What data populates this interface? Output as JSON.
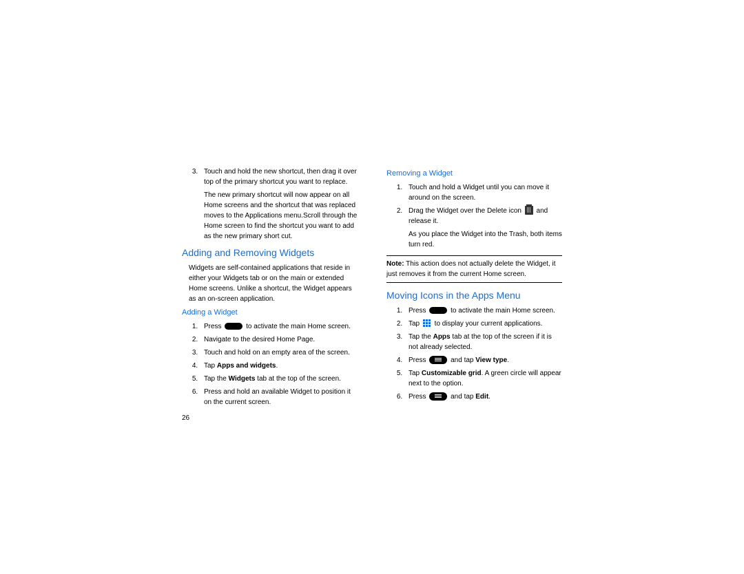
{
  "pageNumber": "26",
  "left": {
    "topList": {
      "start": 3,
      "items": [
        {
          "text": "Touch and hold the new shortcut, then drag it over top of the primary shortcut you want to replace.",
          "after": "The new primary shortcut will now appear on all Home screens and the shortcut that was replaced moves to the Applications menu.Scroll through the Home screen to find the shortcut you want to add as the new primary short cut."
        }
      ]
    },
    "section1": {
      "title": "Adding and Removing Widgets",
      "intro": "Widgets are self-contained applications that reside in either your Widgets tab or on the main or extended Home screens. Unlike a shortcut, the Widget appears as an on-screen application.",
      "sub": "Adding a Widget",
      "steps": [
        {
          "pre": "Press ",
          "icon": "home",
          "post": " to activate the main Home screen."
        },
        {
          "text": "Navigate to the desired Home Page."
        },
        {
          "text": "Touch and hold on an empty area of the screen."
        },
        {
          "pre": "Tap ",
          "bold": "Apps and widgets",
          "post": "."
        },
        {
          "pre": "Tap the ",
          "bold": "Widgets",
          "post": " tab at the top of the screen."
        },
        {
          "text": "Press and hold an available Widget to position it on the current screen."
        }
      ]
    }
  },
  "right": {
    "sub": "Removing a Widget",
    "steps": [
      {
        "text": "Touch and hold a Widget until you can move it around on the screen."
      },
      {
        "pre": "Drag the Widget over the Delete icon ",
        "icon": "trash",
        "post": " and release it.",
        "after": "As you place the Widget into the Trash, both items turn red."
      }
    ],
    "note": {
      "label": "Note:",
      "text": " This action does not actually delete the Widget, it just removes it from the current Home screen."
    },
    "section2": {
      "title": "Moving Icons in the Apps Menu",
      "steps": [
        {
          "pre": "Press ",
          "icon": "home",
          "post": " to activate the main Home screen."
        },
        {
          "pre": "Tap ",
          "icon": "grid",
          "post": " to display your current applications."
        },
        {
          "pre": "Tap the ",
          "bold": "Apps",
          "post": " tab at the top of the screen if it is not already selected."
        },
        {
          "pre": "Press ",
          "icon": "menu",
          "post": " and tap ",
          "bold2": "View type",
          "post2": "."
        },
        {
          "pre": "Tap ",
          "bold": "Customizable grid",
          "post": ". A green circle will appear next to the option."
        },
        {
          "pre": "Press ",
          "icon": "menu",
          "post": " and tap ",
          "bold2": "Edit",
          "post2": "."
        }
      ]
    }
  }
}
